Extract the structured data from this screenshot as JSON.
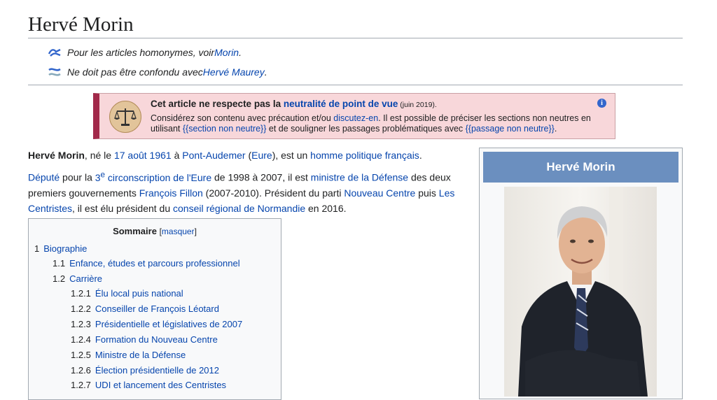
{
  "page": {
    "title": "Hervé Morin"
  },
  "hatnotes": [
    {
      "prefix": "Pour les articles homonymes, voir ",
      "link": "Morin",
      "suffix": "."
    },
    {
      "prefix": "Ne doit pas être confondu avec ",
      "link": "Hervé Maurey",
      "suffix": "."
    }
  ],
  "ambox": {
    "title_prefix": "Cet article ne respecte pas la ",
    "title_link": "neutralité de point de vue",
    "title_date": " (juin 2019).",
    "line1_prefix": "Considérez son contenu avec précaution et/ou ",
    "line1_link": "discutez-en",
    "line1_suffix": ". Il est possible de préciser les sections non neutres en",
    "line2_prefix": "utilisant ",
    "line2_link1": "{{section non neutre}}",
    "line2_mid": " et de souligner les passages problématiques avec ",
    "line2_link2": "{{passage non neutre}}",
    "line2_suffix": ".",
    "info_glyph": "i",
    "colors": {
      "background": "#f8d7da",
      "accent": "#a2294a"
    }
  },
  "lead": {
    "p1": {
      "name": "Hervé Morin",
      "t1": ", né le ",
      "date_link": "17 août 1961",
      "t2": " à ",
      "place_link": "Pont-Audemer",
      "t3": " (",
      "dept_link": "Eure",
      "t4": "), est un ",
      "role_link": "homme politique français",
      "t5": "."
    },
    "p2": {
      "depute_link": "Député",
      "t1": " pour la ",
      "circ_num": "3",
      "circ_sup": "e",
      "circ_link": " circonscription de l'Eure",
      "t2": " de 1998 à 2007, il est ",
      "minister_link": "ministre de la Défense",
      "t3": " des deux premiers gouvernements ",
      "fillon_link": "François Fillon",
      "t4": " (2007-2010). Président du parti ",
      "nc_link": "Nouveau Centre",
      "t5": " puis ",
      "lc_link": "Les Centristes",
      "t6": ", il est élu président du ",
      "cr_link": "conseil régional de Normandie",
      "t7": " en 2016."
    }
  },
  "toc": {
    "title": "Sommaire",
    "toggle_open": "[",
    "toggle": "masquer",
    "toggle_close": "]",
    "items": [
      {
        "num": "1",
        "label": "Biographie"
      },
      {
        "num": "1.1",
        "label": "Enfance, études et parcours professionnel"
      },
      {
        "num": "1.2",
        "label": "Carrière"
      },
      {
        "num": "1.2.1",
        "label": "Élu local puis national"
      },
      {
        "num": "1.2.2",
        "label": "Conseiller de François Léotard"
      },
      {
        "num": "1.2.3",
        "label": "Présidentielle et législatives de 2007"
      },
      {
        "num": "1.2.4",
        "label": "Formation du Nouveau Centre"
      },
      {
        "num": "1.2.5",
        "label": "Ministre de la Défense"
      },
      {
        "num": "1.2.6",
        "label": "Élection présidentielle de 2012"
      },
      {
        "num": "1.2.7",
        "label": "UDI et lancement des Centristes"
      }
    ]
  },
  "infobox": {
    "title": "Hervé Morin",
    "header_color": "#6b8fbf"
  }
}
